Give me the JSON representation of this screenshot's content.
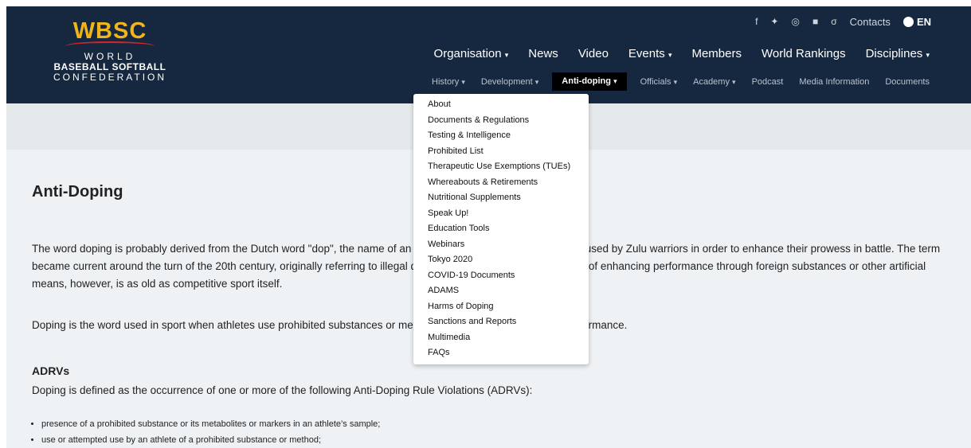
{
  "logo": {
    "wbsc": "WBSC",
    "line1": "WORLD",
    "line2": "BASEBALL SOFTBALL",
    "line3": "CONFEDERATION"
  },
  "utility": {
    "icons": [
      "facebook-icon",
      "twitter-icon",
      "instagram-icon",
      "youtube-icon",
      "weibo-icon"
    ],
    "icon_glyphs": [
      "f",
      "✦",
      "◎",
      "■",
      "σ"
    ],
    "contacts": "Contacts",
    "lang": "EN"
  },
  "main_nav": [
    "Organisation",
    "News",
    "Video",
    "Events",
    "Members",
    "World Rankings",
    "Disciplines"
  ],
  "main_nav_carets": [
    true,
    false,
    false,
    true,
    false,
    false,
    true
  ],
  "sub_nav": [
    "History",
    "Development",
    "Anti-doping",
    "Officials",
    "Academy",
    "Podcast",
    "Media Information",
    "Documents"
  ],
  "sub_nav_carets": [
    true,
    true,
    true,
    true,
    true,
    false,
    false,
    false
  ],
  "sub_nav_active_index": 2,
  "caret_glyph": "▾",
  "dropdown": [
    "About",
    "Documents & Regulations",
    "Testing & Intelligence",
    "Prohibited List",
    "Therapeutic Use Exemptions (TUEs)",
    "Whereabouts & Retirements",
    "Nutritional Supplements",
    "Speak Up!",
    "Education Tools",
    "Webinars",
    "Tokyo 2020",
    "COVID-19 Documents",
    "ADAMS",
    "Harms of Doping",
    "Sanctions and Reports",
    "Multimedia",
    "FAQs"
  ],
  "page": {
    "title": "Anti-Doping",
    "p1": "The word doping is probably derived from the Dutch word \"dop\", the name of an alcoholic drink made of grape skins used by Zulu warriors in order to enhance their prowess in battle. The term became current around the turn of the 20th century, originally referring to illegal drugging of racehorses. The practice of enhancing performance through foreign substances or other artificial means, however, is as old as competitive sport itself.",
    "p2": "Doping is the word used in sport when athletes use prohibited substances or methods to enhance their sporting performance.",
    "adrvs_title": "ADRVs",
    "p3": "Doping is defined as the occurrence of one or more of the following Anti-Doping Rule Violations (ADRVs):",
    "bullets": [
      "presence of a prohibited substance or its metabolites or markers in an athlete’s sample;",
      "use or attempted use by an athlete of a prohibited substance or method;"
    ]
  },
  "colors": {
    "header_bg": "#16283f",
    "accent_gold": "#f0b41d",
    "accent_red": "#d8232a",
    "page_bg": "#eef2f5"
  }
}
